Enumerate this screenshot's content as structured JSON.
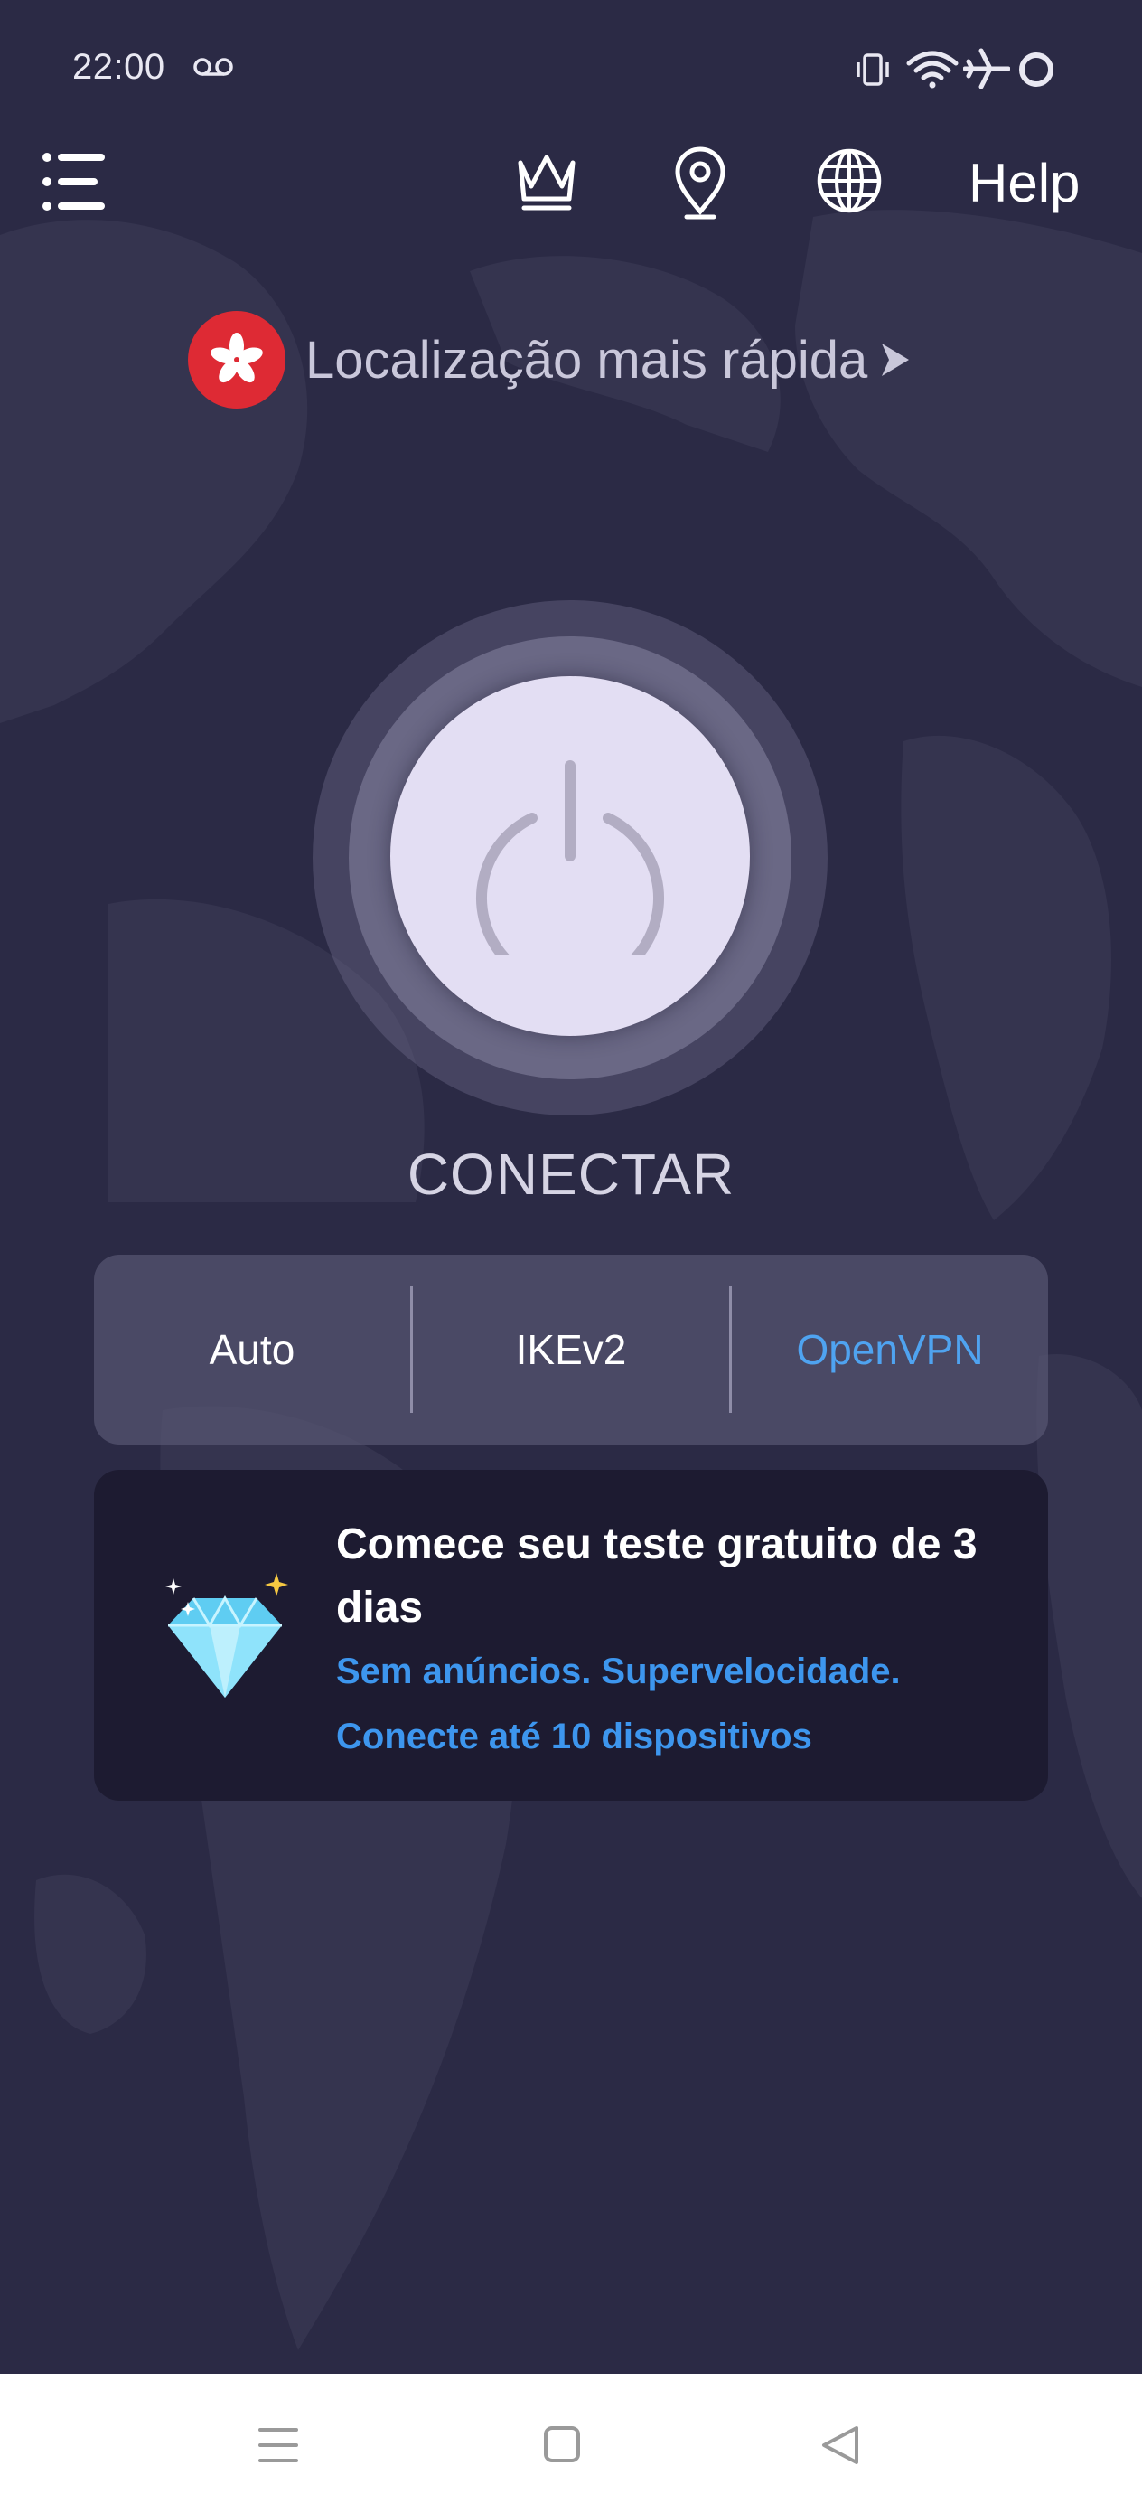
{
  "status_bar": {
    "time": "22:00",
    "icons": [
      "voicemail-icon",
      "vibrate-icon",
      "wifi-icon",
      "airplane-icon",
      "battery-ring-icon"
    ]
  },
  "toolbar": {
    "menu_icon": "menu-icon",
    "premium_icon": "crown-icon",
    "location_icon": "location-pin-icon",
    "language_icon": "globe-icon",
    "help_label": "Help"
  },
  "location": {
    "label": "Localização mais rápida",
    "flag": "hong-kong-flag-icon"
  },
  "connect": {
    "label": "CONECTAR"
  },
  "protocols": {
    "options": [
      "Auto",
      "IKEv2",
      "OpenVPN"
    ],
    "selected": "OpenVPN"
  },
  "promo": {
    "title": "Comece seu teste gratuito de 3 dias",
    "line1": "Sem anúncios. Supervelocidade.",
    "line2": "Conecte até 10 dispositivos"
  },
  "colors": {
    "background": "#2b2a45",
    "accent": "#4fa3f0",
    "promo_link": "#3d96ee",
    "flag_red": "#de2a34",
    "power_button": "#e3def3"
  }
}
